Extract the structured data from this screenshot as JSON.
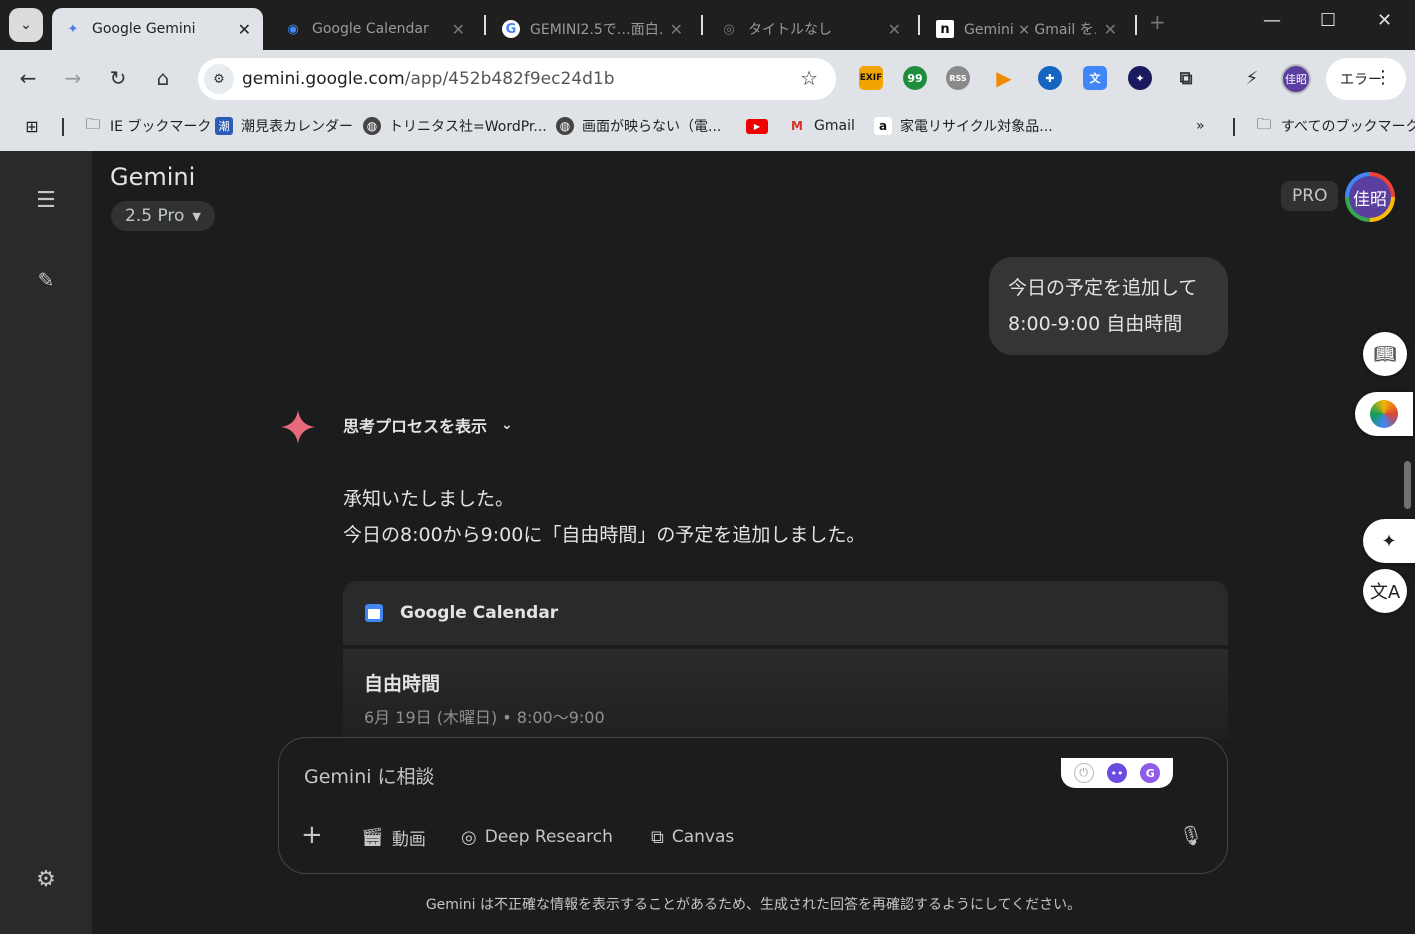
{
  "browser": {
    "tabs": [
      {
        "title": "Google Gemini",
        "icon": "gemini-sparkle-icon",
        "active": true
      },
      {
        "title": "Google Calendar",
        "icon": "calendar-check-icon",
        "active": false
      },
      {
        "title": "GEMINI2.5で…面白…",
        "icon": "google-g-icon",
        "active": false
      },
      {
        "title": "タイトルなし",
        "icon": "chrome-icon",
        "active": false
      },
      {
        "title": "Gemini × Gmail を…",
        "icon": "note-icon",
        "active": false
      }
    ],
    "url_host": "gemini.google.com",
    "url_path": "/app/452b482f9ec24d1b",
    "error_label": "エラー",
    "profile_initials": "佳昭",
    "extensions": [
      {
        "label": "EXIF",
        "color": "#f2a400"
      },
      {
        "label": "99",
        "color": "#1e8e3e"
      },
      {
        "label": "RSS",
        "color": "#8a8a8a"
      },
      {
        "label": "▶",
        "color": "#f28b00"
      },
      {
        "label": "✚",
        "color": "#1565c0"
      },
      {
        "label": "文",
        "color": "#4285f4"
      },
      {
        "label": "✦",
        "color": "#1a1a5e"
      }
    ],
    "bookmarks": [
      {
        "label": "IE ブックマーク",
        "icon": "folder-icon"
      },
      {
        "label": "潮見表カレンダー",
        "icon": "tide-icon"
      },
      {
        "label": "トリニタス社=WordPr...",
        "icon": "globe-icon"
      },
      {
        "label": "画面が映らない（電...",
        "icon": "globe-icon"
      },
      {
        "label": "",
        "icon": "youtube-icon"
      },
      {
        "label": "Gmail",
        "icon": "gmail-icon"
      },
      {
        "label": "家電リサイクル対象品...",
        "icon": "amazon-icon"
      }
    ],
    "all_bookmarks_label": "すべてのブックマーク"
  },
  "gemini": {
    "brand": "Gemini",
    "model": "2.5 Pro",
    "pro_badge": "PRO",
    "avatar_initials": "佳昭",
    "user_message_line1": "今日の予定を追加して",
    "user_message_line2": "8:00-9:00 自由時間",
    "thinking_label": "思考プロセスを表示",
    "answer_line1": "承知いたしました。",
    "answer_line2": "今日の8:00から9:00に「自由時間」の予定を追加しました。",
    "calendar_card_title": "Google Calendar",
    "event_title": "自由時間",
    "event_when": "6月 19日 (木曜日) • 8:00～9:00",
    "composer_placeholder": "Gemini に相談",
    "tools": {
      "video": "動画",
      "deep_research": "Deep Research",
      "canvas": "Canvas"
    },
    "disclaimer": "Gemini は不正確な情報を表示することがあるため、生成された回答を再確認するようにしてください。"
  },
  "colors": {
    "app_bg": "#1b1c1d",
    "rail_bg": "#282a2c",
    "bubble_bg": "#333537",
    "accent_sparkle": "#e8697b"
  }
}
